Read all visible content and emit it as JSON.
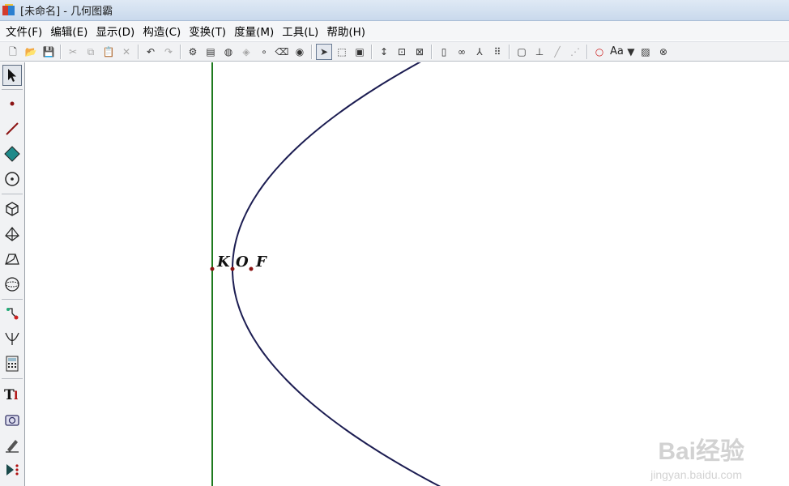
{
  "window": {
    "title": "[未命名] - 几何图霸"
  },
  "menubar": {
    "items": [
      "文件(F)",
      "编辑(E)",
      "显示(D)",
      "构造(C)",
      "变换(T)",
      "度量(M)",
      "工具(L)",
      "帮助(H)"
    ]
  },
  "toolbar": {
    "font_label": "Aa"
  },
  "canvas": {
    "points": {
      "K": "K",
      "O": "O",
      "F": "F"
    },
    "colors": {
      "directrix": "#1e7a1e",
      "parabola": "#1c1d52",
      "point": "#8c1414"
    }
  },
  "watermark": {
    "brand": "Bai经验",
    "url": "jingyan.baidu.com"
  }
}
